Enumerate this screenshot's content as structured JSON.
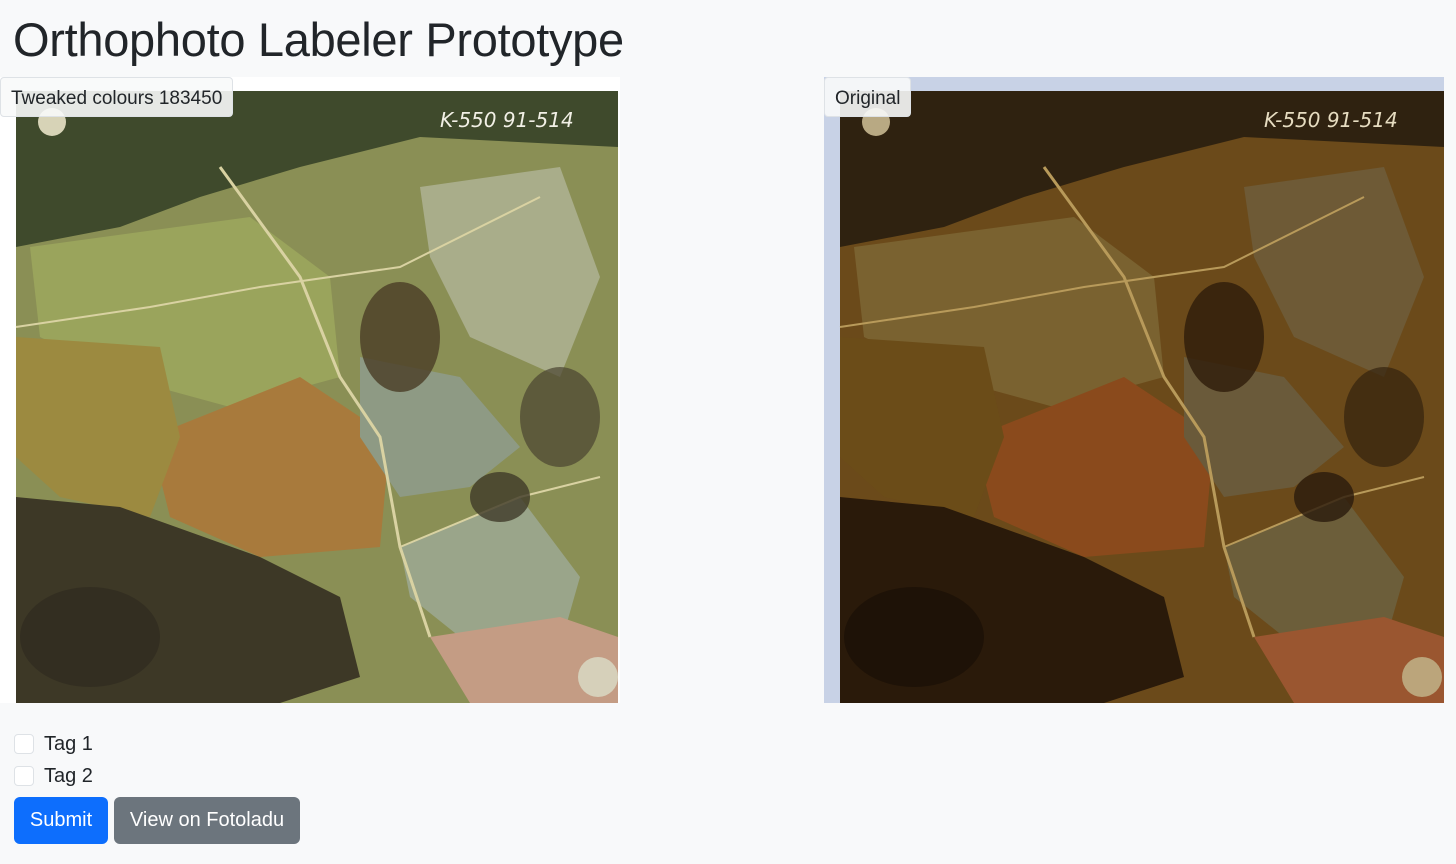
{
  "page": {
    "title": "Orthophoto Labeler Prototype"
  },
  "tweaked_panel": {
    "label": "Tweaked colours 183450",
    "frame_code": "K-550 91-514"
  },
  "original_panel": {
    "label": "Original",
    "frame_code": "K-550 91-514"
  },
  "tags": [
    {
      "label": "Tag 1",
      "checked": false
    },
    {
      "label": "Tag 2",
      "checked": false
    }
  ],
  "buttons": {
    "submit": "Submit",
    "view": "View on Fotoladu"
  },
  "colors": {
    "primary": "#0d6efd",
    "secondary": "#6c757d",
    "background": "#f8f9fa"
  }
}
